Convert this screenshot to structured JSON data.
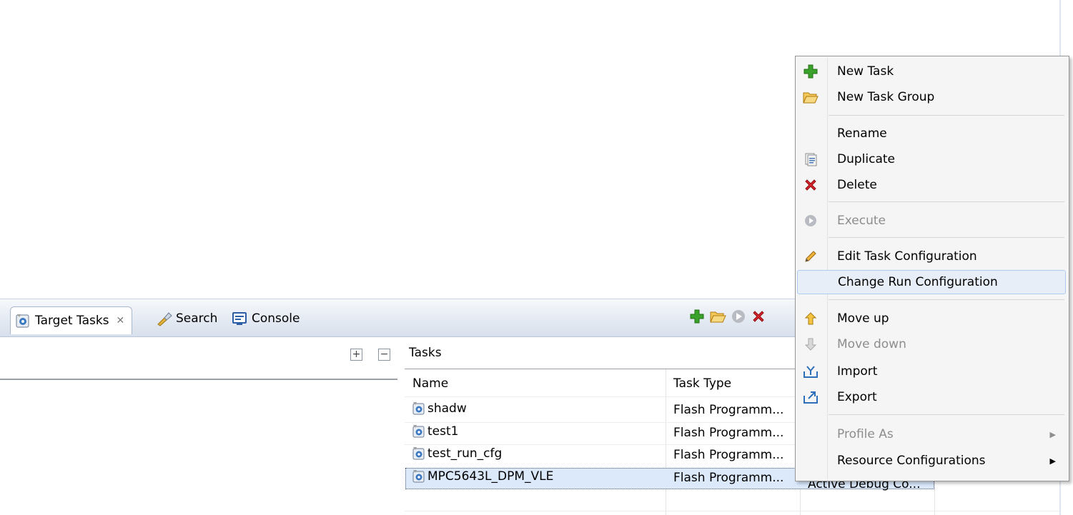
{
  "tabs": {
    "target_tasks": "Target Tasks",
    "search": "Search",
    "console": "Console",
    "close_glyph": "✕"
  },
  "left_pane": {
    "expand_glyph": "+",
    "collapse_glyph": "−"
  },
  "tasks": {
    "label": "Tasks",
    "columns": [
      "Name",
      "Task Type",
      ""
    ],
    "rows": [
      {
        "name": "shadw",
        "type": "Flash Programm...",
        "run": ""
      },
      {
        "name": "test1",
        "type": "Flash Programm...",
        "run": ""
      },
      {
        "name": "test_run_cfg",
        "type": "Flash Programm...",
        "run": ""
      },
      {
        "name": "MPC5643L_DPM_VLE",
        "type": "Flash Programm...",
        "run": "Active Debug Co...",
        "selected": true
      }
    ]
  },
  "context_menu": {
    "items": [
      {
        "label": "New Task",
        "icon": "green-plus-icon",
        "enabled": true
      },
      {
        "label": "New Task Group",
        "icon": "folder-icon",
        "enabled": true
      },
      {
        "label": "Rename",
        "icon": "",
        "enabled": true
      },
      {
        "label": "Duplicate",
        "icon": "document-icon",
        "enabled": true
      },
      {
        "label": "Delete",
        "icon": "red-x-icon",
        "enabled": true
      },
      {
        "label": "Execute",
        "icon": "play-icon",
        "enabled": false
      },
      {
        "label": "Edit Task Configuration",
        "icon": "pencil-icon",
        "enabled": true
      },
      {
        "label": "Change Run Configuration",
        "icon": "",
        "enabled": true,
        "hover": true
      },
      {
        "label": "Move up",
        "icon": "arrow-up-icon",
        "enabled": true
      },
      {
        "label": "Move down",
        "icon": "arrow-down-icon",
        "enabled": false
      },
      {
        "label": "Import",
        "icon": "import-icon",
        "enabled": true
      },
      {
        "label": "Export",
        "icon": "export-icon",
        "enabled": true
      },
      {
        "label": "Profile As",
        "icon": "",
        "enabled": false,
        "submenu": true
      },
      {
        "label": "Resource Configurations",
        "icon": "",
        "enabled": true,
        "submenu": true
      }
    ],
    "submenu_arrow": "▶"
  },
  "colors": {
    "selection": "#dbe9fb",
    "tab_bar": "#e3e9f2",
    "menu_bg": "#f5f5f5",
    "menu_hover": "#e8eef7",
    "add_green": "#3aa12a",
    "delete_red": "#d9232a",
    "folder_orange": "#e8a21c"
  }
}
